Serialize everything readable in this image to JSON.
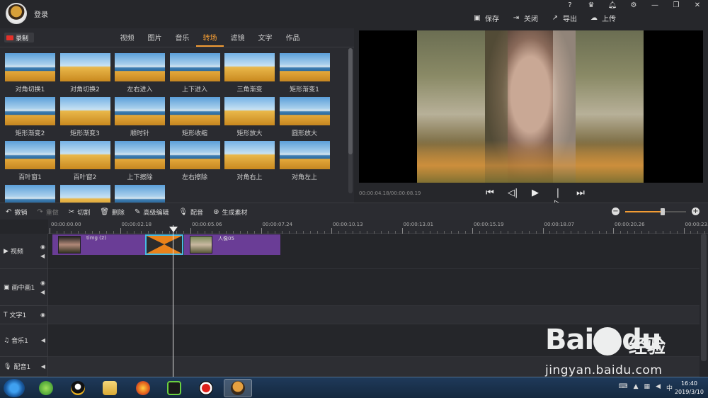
{
  "titlebar": {
    "login_label": "登录",
    "window_icons": [
      "?",
      "VIP",
      "bell",
      "gear",
      "—",
      "❐",
      "✕"
    ],
    "actions": [
      {
        "icon": "save-icon",
        "label": "保存"
      },
      {
        "icon": "close-doc-icon",
        "label": "关闭"
      },
      {
        "icon": "export-icon",
        "label": "导出"
      },
      {
        "icon": "upload-icon",
        "label": "上传"
      }
    ]
  },
  "library": {
    "record_label": "录制",
    "tabs": [
      "视频",
      "图片",
      "音乐",
      "转场",
      "滤镜",
      "文字",
      "作品"
    ],
    "active_tab": "转场",
    "transitions": [
      "对角切换1",
      "对角切换2",
      "左右进入",
      "上下进入",
      "三角渐变",
      "矩形渐变1",
      "矩形渐变2",
      "矩形渐变3",
      "顺时针",
      "矩形收缩",
      "矩形放大",
      "圆形放大",
      "百叶窗1",
      "百叶窗2",
      "上下擦除",
      "左右擦除",
      "对角右上",
      "对角左上",
      "",
      "",
      ""
    ]
  },
  "preview": {
    "time_readout": "00:00:04.18/00:00:08.19",
    "controls": [
      "skip-start-icon",
      "step-back-icon",
      "play-icon",
      "step-forward-icon",
      "skip-end-icon"
    ]
  },
  "toolbar": {
    "undo": "撤销",
    "redo": "重做",
    "cut": "切割",
    "delete": "删除",
    "advanced_edit": "高级编辑",
    "dub": "配音",
    "generate": "生成素材",
    "zoom_level": 0.62
  },
  "timeline": {
    "ruler": [
      "00:00:00.00",
      "00:00:02.18",
      "00:00:05.06",
      "00:00:07.24",
      "00:00:10.13",
      "00:00:13.01",
      "00:00:15.19",
      "00:00:18.07",
      "00:00:20.26",
      "00:00:23."
    ],
    "tracks": [
      {
        "label": "视频",
        "icon": "video-track-icon"
      },
      {
        "label": "画中画1",
        "icon": "pip-track-icon"
      },
      {
        "label": "文字1",
        "icon": "text-track-icon"
      },
      {
        "label": "音乐1",
        "icon": "music-track-icon"
      },
      {
        "label": "配音1",
        "icon": "mic-track-icon"
      }
    ],
    "clips": [
      {
        "name": "timg (2)"
      },
      {
        "name": "人像05"
      }
    ]
  },
  "taskbar": {
    "time": "16:40",
    "date": "2019/3/10"
  },
  "watermark": {
    "brand": "Bai",
    "brand2": "du",
    "cn": "经验",
    "url": "jingyan.baidu.com"
  },
  "colors": {
    "accent": "#f39c34",
    "clip": "#6a3d96",
    "transition": "#e9821a",
    "record": "#e4312a"
  }
}
